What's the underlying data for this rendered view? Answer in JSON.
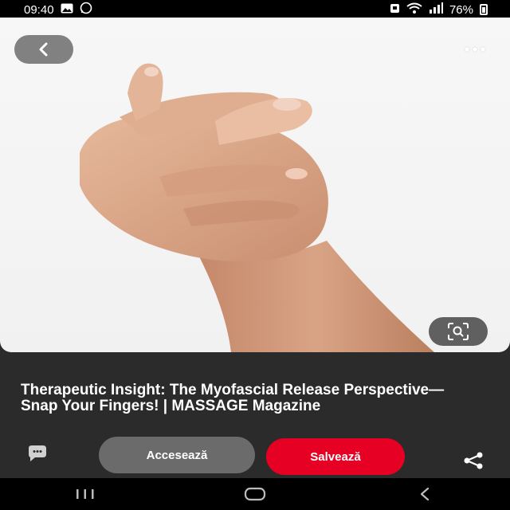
{
  "status_bar": {
    "time": "09:40",
    "battery": "76%"
  },
  "pin": {
    "title": "Therapeutic Insight: The Myofascial Release Perspective—Snap Your Fingers! | MASSAGE Magazine"
  },
  "actions": {
    "visit_label": "Accesează",
    "save_label": "Salvează"
  },
  "colors": {
    "save": "#e60023",
    "visit": "#6b6b6b",
    "panel": "#2b2b2b"
  },
  "icons": {
    "back": "chevron-left-icon",
    "more": "more-horizontal-icon",
    "lens": "visual-search-icon",
    "comment": "comment-icon",
    "share": "share-icon"
  }
}
